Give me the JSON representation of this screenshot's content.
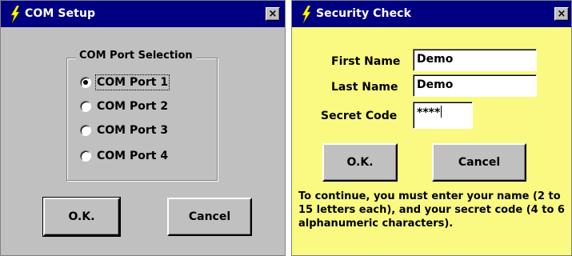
{
  "com_setup": {
    "title": "COM Setup",
    "close_label": "×",
    "group_label": "COM Port Selection",
    "ports": [
      {
        "label": "COM Port 1",
        "selected": true
      },
      {
        "label": "COM Port 2",
        "selected": false
      },
      {
        "label": "COM Port 3",
        "selected": false
      },
      {
        "label": "COM Port 4",
        "selected": false
      }
    ],
    "ok_label": "O.K.",
    "cancel_label": "Cancel"
  },
  "security_check": {
    "title": "Security Check",
    "close_label": "×",
    "first_name_label": "First Name",
    "first_name_value": "Demo",
    "last_name_label": "Last Name",
    "last_name_value": "Demo",
    "secret_code_label": "Secret Code",
    "secret_code_value": "****",
    "ok_label": "O.K.",
    "cancel_label": "Cancel",
    "instructions": "To continue, you must enter your name (2 to 15 letters each), and your secret code (4 to 6 alphanumeric characters)."
  },
  "colors": {
    "titlebar": "#000080",
    "dialog_gray": "#c0c0c0",
    "security_bg": "#ffff80",
    "lightning": "#ffff00"
  },
  "icons": {
    "title_icon": "lightning-bolt-icon",
    "close_icon": "close-icon"
  }
}
